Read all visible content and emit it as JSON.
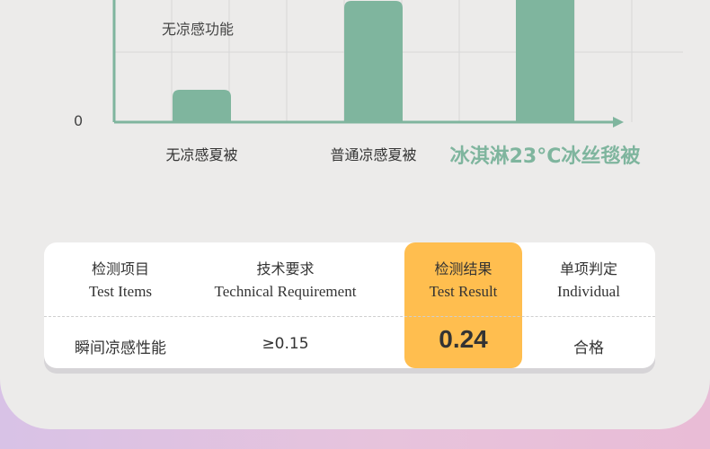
{
  "chart_data": {
    "type": "bar",
    "categories": [
      "无凉感夏被",
      "普通凉感夏被",
      "冰淇淋23°C冰丝毯被"
    ],
    "values": [
      0.04,
      0.15,
      0.24
    ],
    "y_tick_labels": [
      "0"
    ],
    "annotations": [
      "无凉感功能"
    ],
    "bar_color": "#7fb59e",
    "highlight_label_color": "#7fb59e",
    "grid": true
  },
  "table": {
    "columns": [
      {
        "cn": "检测项目",
        "en": "Test Items"
      },
      {
        "cn": "技术要求",
        "en": "Technical Requirement"
      },
      {
        "cn": "检测结果",
        "en": "Test Result"
      },
      {
        "cn": "单项判定",
        "en": "Individual"
      }
    ],
    "row": [
      "瞬间凉感性能",
      "≥0.15",
      "0.24",
      "合格"
    ],
    "highlight_color": "#ffbe4f"
  }
}
